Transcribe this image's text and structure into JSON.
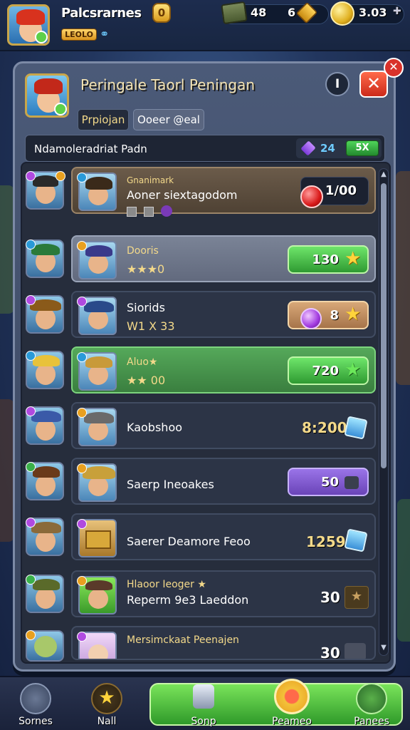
{
  "header": {
    "player_name": "Palcsrarnes",
    "coin_badge": "0",
    "level_label": "LEOLO",
    "resources": [
      {
        "name": "wood",
        "value": "48"
      },
      {
        "name": "crate",
        "value": "6"
      },
      {
        "name": "gold",
        "value": "3.03"
      }
    ]
  },
  "panel": {
    "title": "Peringale Taorl Peningan",
    "info_label": "I",
    "close_label": "✕",
    "tabs": [
      "Prpiojan",
      "Ooeer @eal"
    ],
    "filter_text": "Ndamoleradriat Padn",
    "filter_gem_count": "24",
    "filter_button": "5X"
  },
  "rows": [
    {
      "name": "Gnanimark",
      "title": "Aoner siextagodom",
      "price": "1/00",
      "price_style": "dark-red"
    },
    {
      "name": "Dooris",
      "title": "",
      "sub": "★★★0",
      "price": "130",
      "price_style": "green-star"
    },
    {
      "name": "",
      "title": "Siorids",
      "sub": "W1 X 33",
      "price": "8",
      "price_style": "tan-purple"
    },
    {
      "name": "Aluo★",
      "title": "",
      "sub": "★★ 00",
      "price": "720",
      "price_style": "green-star"
    },
    {
      "name": "",
      "title": "Kaobshoo",
      "price": "8:200",
      "price_style": "plain-gem"
    },
    {
      "name": "",
      "title": "Saerp Ineoakes",
      "price": "50",
      "price_style": "purple"
    },
    {
      "name": "",
      "title": "Saerer Deamore Feoo",
      "price": "1259",
      "price_style": "plain-gem"
    },
    {
      "name": "Hlaoor Ieoger ★",
      "title": "Reperm 9e3 Laeddon",
      "price": "30",
      "price_style": "plain-dark"
    },
    {
      "name": "Mersimckaat Peenajen",
      "title": "",
      "price": "30",
      "price_style": "plain-dark"
    }
  ],
  "bottom_nav": [
    {
      "label": "Sornes"
    },
    {
      "label": "Nall"
    },
    {
      "label": "Sonp"
    },
    {
      "label": "Peameo"
    },
    {
      "label": "Panees"
    }
  ],
  "colors": {
    "accent_gold": "#f3d98a",
    "green_button": "#3fae3a",
    "purple_button": "#7a54c8",
    "panel_bg": "#262d3c"
  }
}
